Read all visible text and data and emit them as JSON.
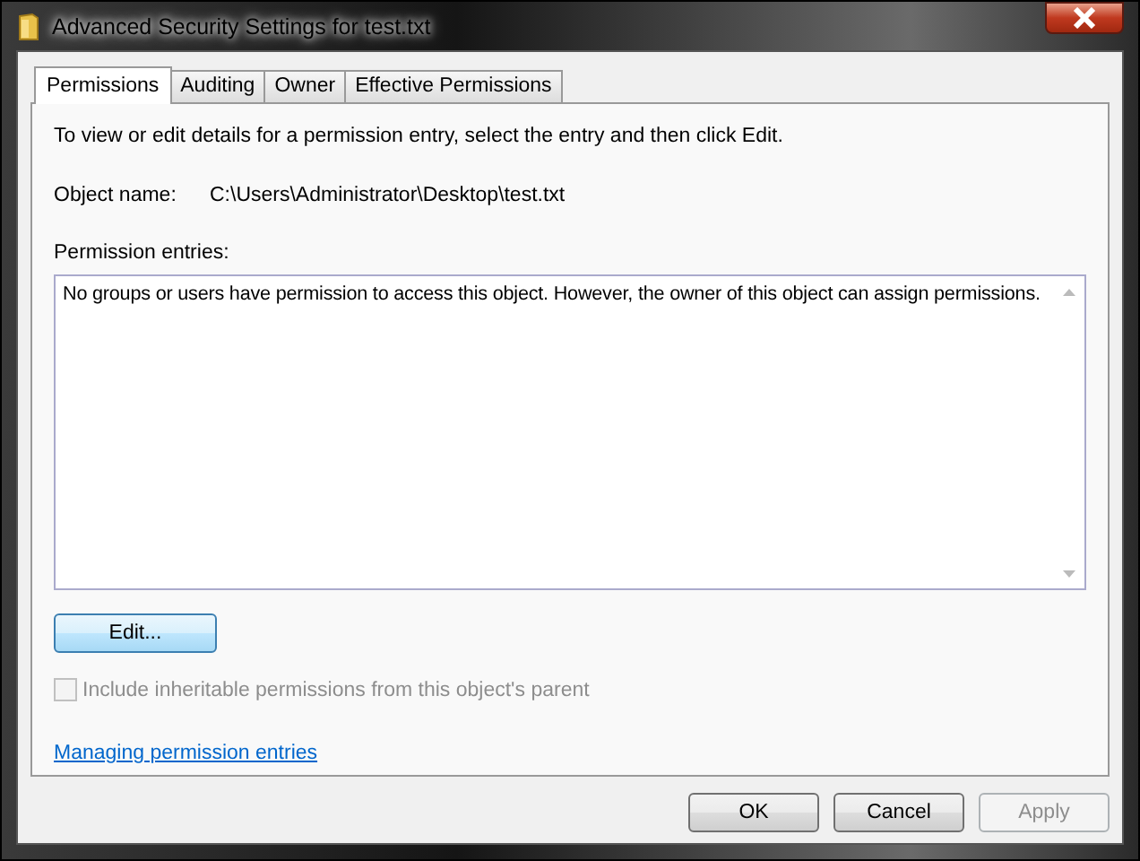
{
  "window": {
    "title": "Advanced Security Settings for test.txt"
  },
  "tabs": [
    {
      "label": "Permissions",
      "selected": true
    },
    {
      "label": "Auditing",
      "selected": false
    },
    {
      "label": "Owner",
      "selected": false
    },
    {
      "label": "Effective Permissions",
      "selected": false
    }
  ],
  "instruction": "To view or edit details for a permission entry, select the entry and then click Edit.",
  "object_name": {
    "label": "Object name:",
    "value": "C:\\Users\\Administrator\\Desktop\\test.txt"
  },
  "permission_entries": {
    "label": "Permission entries:",
    "message": "No groups or users have permission to access this object. However, the owner of this object can assign permissions."
  },
  "edit_button": "Edit...",
  "inherit_checkbox": {
    "label": "Include inheritable permissions from this object's parent",
    "checked": false,
    "disabled": true
  },
  "help_link": "Managing permission entries",
  "buttons": [
    {
      "label": "OK",
      "disabled": false
    },
    {
      "label": "Cancel",
      "disabled": false
    },
    {
      "label": "Apply",
      "disabled": true
    }
  ]
}
